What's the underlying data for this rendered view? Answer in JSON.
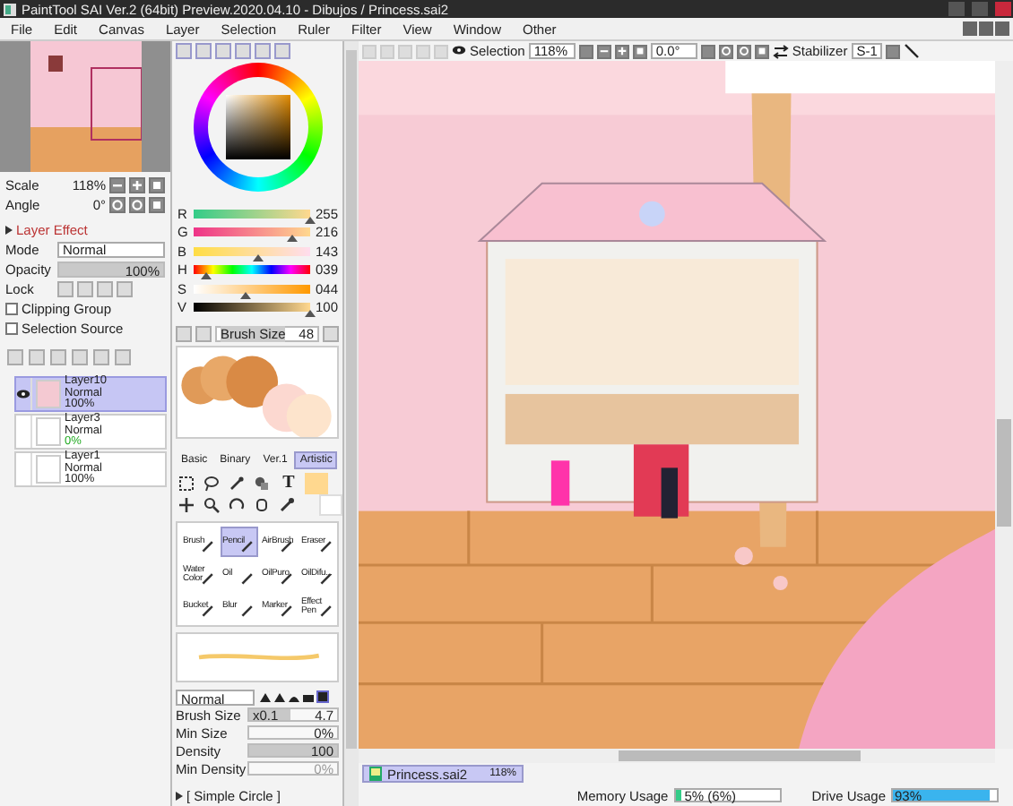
{
  "window": {
    "title": "PaintTool SAI Ver.2 (64bit) Preview.2020.04.10 - Dibujos / Princess.sai2"
  },
  "menu": [
    "File",
    "Edit",
    "Canvas",
    "Layer",
    "Selection",
    "Ruler",
    "Filter",
    "View",
    "Window",
    "Other"
  ],
  "toolbar": {
    "selection_label": "Selection",
    "zoom": "118%",
    "angle": "0.0°",
    "stabilizer_label": "Stabilizer",
    "stabilizer": "S-1"
  },
  "navigator": {
    "scale_label": "Scale",
    "scale": "118%",
    "angle_label": "Angle",
    "angle": "0°"
  },
  "layer_panel": {
    "effect_label": "Layer Effect",
    "mode_label": "Mode",
    "mode": "Normal",
    "opacity_label": "Opacity",
    "opacity": {
      "value": "100%",
      "level": 1
    },
    "lock_label": "Lock",
    "clipping_group": {
      "label": "Clipping Group",
      "checked": false
    },
    "selection_source": {
      "label": "Selection Source",
      "checked": false
    },
    "layers": [
      {
        "name": "Layer10",
        "mode": "Normal",
        "opacity": "100%",
        "selected": true,
        "visible": true
      },
      {
        "name": "Layer3",
        "mode": "Normal",
        "opacity": "0%",
        "selected": false,
        "visible": false
      },
      {
        "name": "Layer1",
        "mode": "Normal",
        "opacity": "100%",
        "selected": false,
        "visible": false
      }
    ]
  },
  "color_panel": {
    "channels": [
      {
        "label": "R",
        "value": "255",
        "level": 1
      },
      {
        "label": "G",
        "value": "216",
        "level": 0.85
      },
      {
        "label": "B",
        "value": "143",
        "level": 0.56
      },
      {
        "label": "H",
        "value": "039",
        "level": 0.11
      },
      {
        "label": "S",
        "value": "044",
        "level": 0.44
      },
      {
        "label": "V",
        "value": "100",
        "level": 1
      }
    ],
    "brush_size_label": "Brush Size",
    "brush_size": "48"
  },
  "tool_tabs": [
    {
      "label": "Basic",
      "selected": false
    },
    {
      "label": "Binary",
      "selected": false
    },
    {
      "label": "Ver.1",
      "selected": false
    },
    {
      "label": "Artistic",
      "selected": true
    }
  ],
  "text_tool": "T",
  "brushes": [
    {
      "name": "Brush",
      "selected": false
    },
    {
      "name": "Pencil",
      "selected": true
    },
    {
      "name": "AirBrush",
      "selected": false
    },
    {
      "name": "Eraser",
      "selected": false
    },
    {
      "name": "Water Color",
      "selected": false
    },
    {
      "name": "Oil",
      "selected": false
    },
    {
      "name": "OilPuro",
      "selected": false
    },
    {
      "name": "OilDifu...",
      "selected": false
    },
    {
      "name": "Bucket",
      "selected": false
    },
    {
      "name": "Blur",
      "selected": false
    },
    {
      "name": "Marker",
      "selected": false
    },
    {
      "name": "Effect Pen",
      "selected": false
    }
  ],
  "brush_settings": {
    "blend_mode": "Normal",
    "size_label": "Brush Size",
    "size_factor": "x0.1",
    "size": {
      "value": "4.7",
      "level": 0.47
    },
    "min_size_label": "Min Size",
    "min_size": {
      "value": "0%",
      "level": 0
    },
    "density_label": "Density",
    "density": {
      "value": "100",
      "level": 1
    },
    "min_density_label": "Min Density",
    "min_density": {
      "value": "0%",
      "level": 0
    },
    "shape": "[ Simple Circle ]"
  },
  "file_tabs": [
    {
      "name": "Princess.sai2",
      "zoom": "118%",
      "selected": true
    }
  ],
  "status_bar": {
    "memory_label": "Memory Usage",
    "memory": {
      "value": "5% (6%)",
      "level": 0.05
    },
    "drive_label": "Drive Usage",
    "drive": {
      "value": "93%",
      "level": 0.93
    }
  }
}
